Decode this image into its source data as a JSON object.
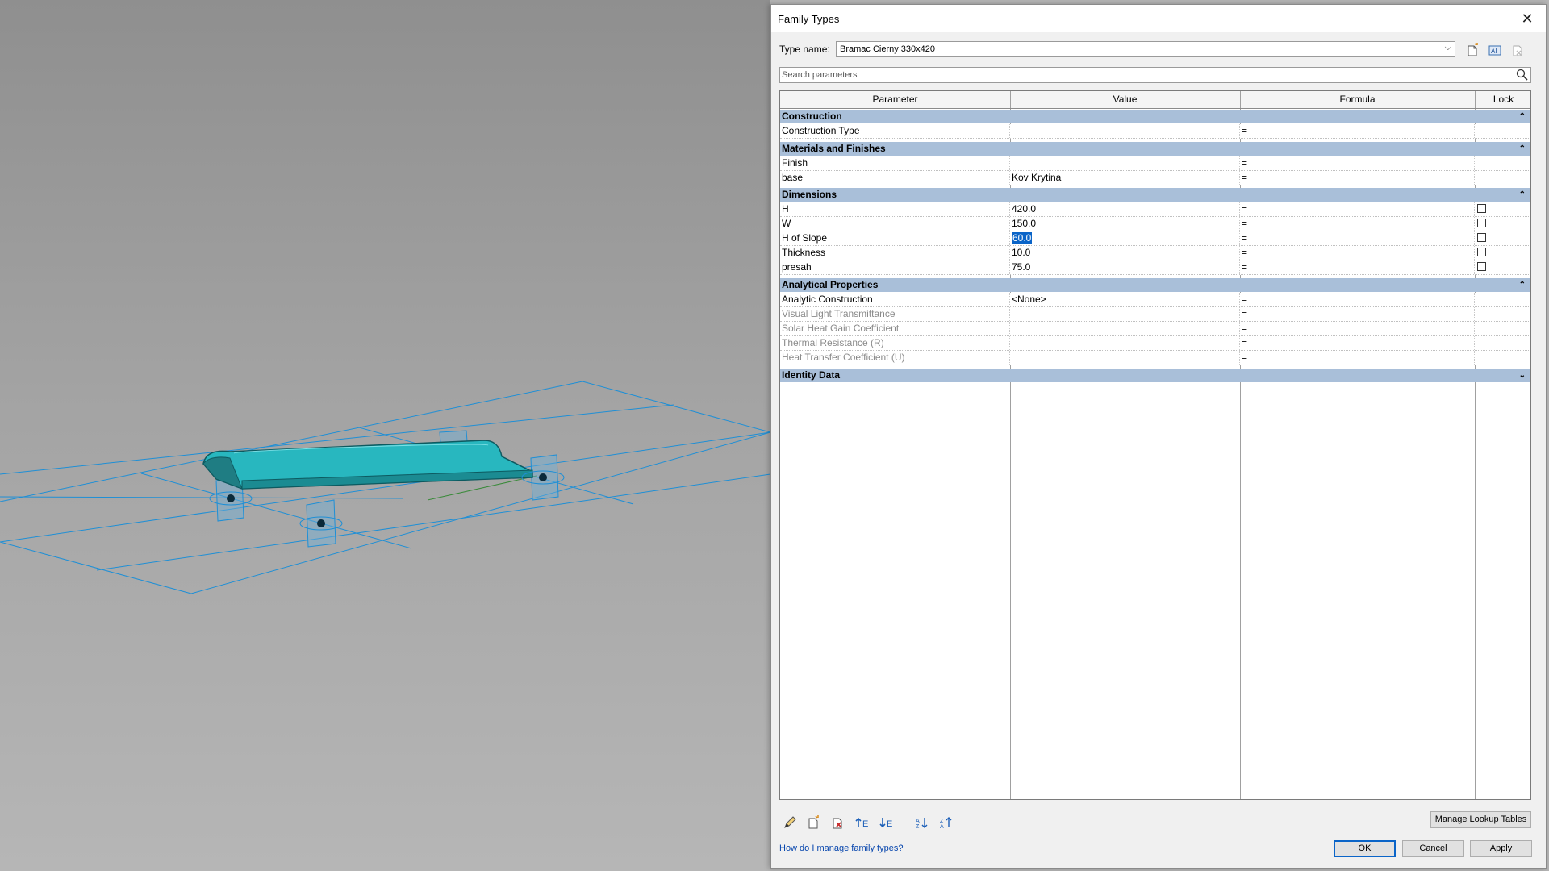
{
  "dialog": {
    "title": "Family Types",
    "close_icon": "close-icon"
  },
  "type_name": {
    "label": "Type name:",
    "value": "Bramac Cierny 330x420"
  },
  "toolbar_icons": [
    "new-type-icon",
    "rename-type-icon",
    "delete-type-icon"
  ],
  "search": {
    "placeholder": "Search parameters"
  },
  "columns": [
    "Parameter",
    "Value",
    "Formula",
    "Lock"
  ],
  "groups": [
    {
      "name": "Construction",
      "expanded": true,
      "rows": [
        {
          "param": "Construction Type",
          "value": "",
          "formula": "="
        }
      ]
    },
    {
      "name": "Materials and Finishes",
      "expanded": true,
      "rows": [
        {
          "param": "Finish",
          "value": "",
          "formula": "="
        },
        {
          "param": "base",
          "value": "Kov Krytina",
          "formula": "="
        }
      ]
    },
    {
      "name": "Dimensions",
      "expanded": true,
      "rows": [
        {
          "param": "H",
          "value": "420.0",
          "formula": "=",
          "lock": false
        },
        {
          "param": "W",
          "value": "150.0",
          "formula": "=",
          "lock": false
        },
        {
          "param": "H of Slope",
          "value": "60.0",
          "formula": "=",
          "lock": false,
          "selected": true
        },
        {
          "param": "Thickness",
          "value": "10.0",
          "formula": "=",
          "lock": false
        },
        {
          "param": "presah",
          "value": "75.0",
          "formula": "=",
          "lock": false
        }
      ]
    },
    {
      "name": "Analytical Properties",
      "expanded": true,
      "rows": [
        {
          "param": "Analytic Construction",
          "value": "<None>",
          "formula": "="
        },
        {
          "param": "Visual Light Transmittance",
          "value": "",
          "formula": "=",
          "disabled": true
        },
        {
          "param": "Solar Heat Gain Coefficient",
          "value": "",
          "formula": "=",
          "disabled": true
        },
        {
          "param": "Thermal Resistance (R)",
          "value": "",
          "formula": "=",
          "disabled": true
        },
        {
          "param": "Heat Transfer Coefficient (U)",
          "value": "",
          "formula": "=",
          "disabled": true
        }
      ]
    },
    {
      "name": "Identity Data",
      "expanded": false,
      "rows": []
    }
  ],
  "bottom_tools": [
    "edit-parameter-icon",
    "new-parameter-icon",
    "delete-parameter-icon",
    "move-up-icon",
    "move-down-icon",
    "sort-ascending-icon",
    "sort-descending-icon"
  ],
  "buttons": {
    "manage_lookup": "Manage Lookup Tables",
    "ok": "OK",
    "cancel": "Cancel",
    "apply": "Apply"
  },
  "help_link": "How do I manage family types?",
  "colors": {
    "group_header": "#a9bfd9",
    "selection": "#0a64c8",
    "model": "#2bbcc4",
    "reference_lines": "#1e8fd6"
  }
}
